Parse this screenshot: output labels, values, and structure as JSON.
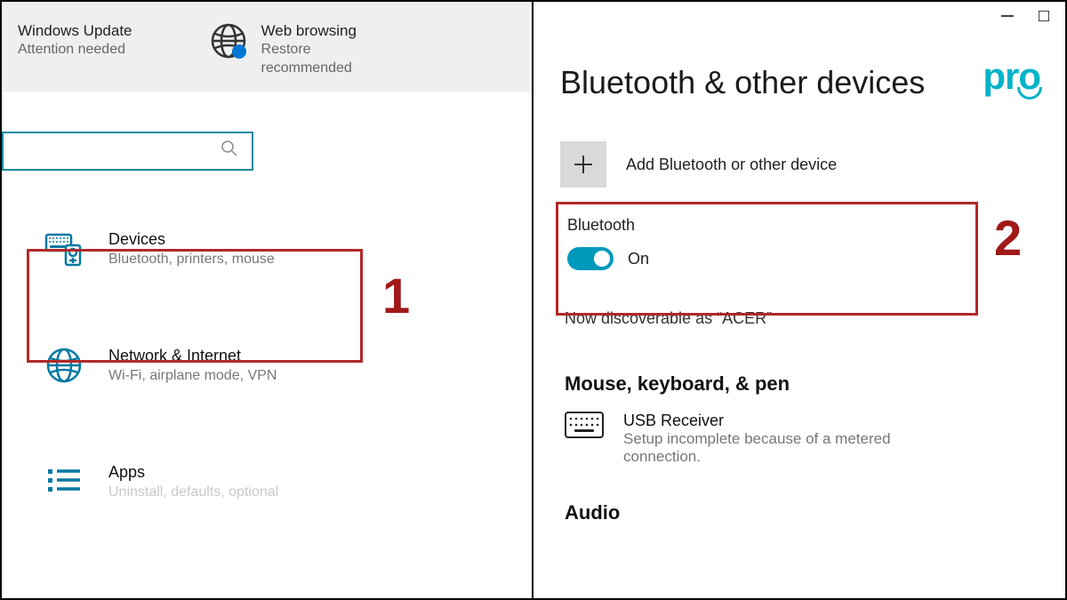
{
  "left": {
    "shortcuts": {
      "windows_update": {
        "title": "Windows Update",
        "sub": "Attention needed"
      },
      "web_browsing": {
        "title": "Web browsing",
        "sub1": "Restore",
        "sub2": "recommended"
      }
    },
    "categories": {
      "devices": {
        "title": "Devices",
        "sub": "Bluetooth, printers, mouse"
      },
      "network": {
        "title": "Network & Internet",
        "sub": "Wi-Fi, airplane mode, VPN"
      },
      "apps": {
        "title": "Apps",
        "sub": "Uninstall, defaults, optional"
      }
    },
    "marker": "1"
  },
  "right": {
    "logo": "pro",
    "title": "Bluetooth & other devices",
    "add_label": "Add Bluetooth or other device",
    "bluetooth": {
      "label": "Bluetooth",
      "state": "On"
    },
    "discoverable": "Now discoverable as “ACER”",
    "section_mkp": "Mouse, keyboard, & pen",
    "device": {
      "name": "USB Receiver",
      "status": "Setup incomplete because of a metered connection."
    },
    "section_audio": "Audio",
    "marker": "2"
  }
}
